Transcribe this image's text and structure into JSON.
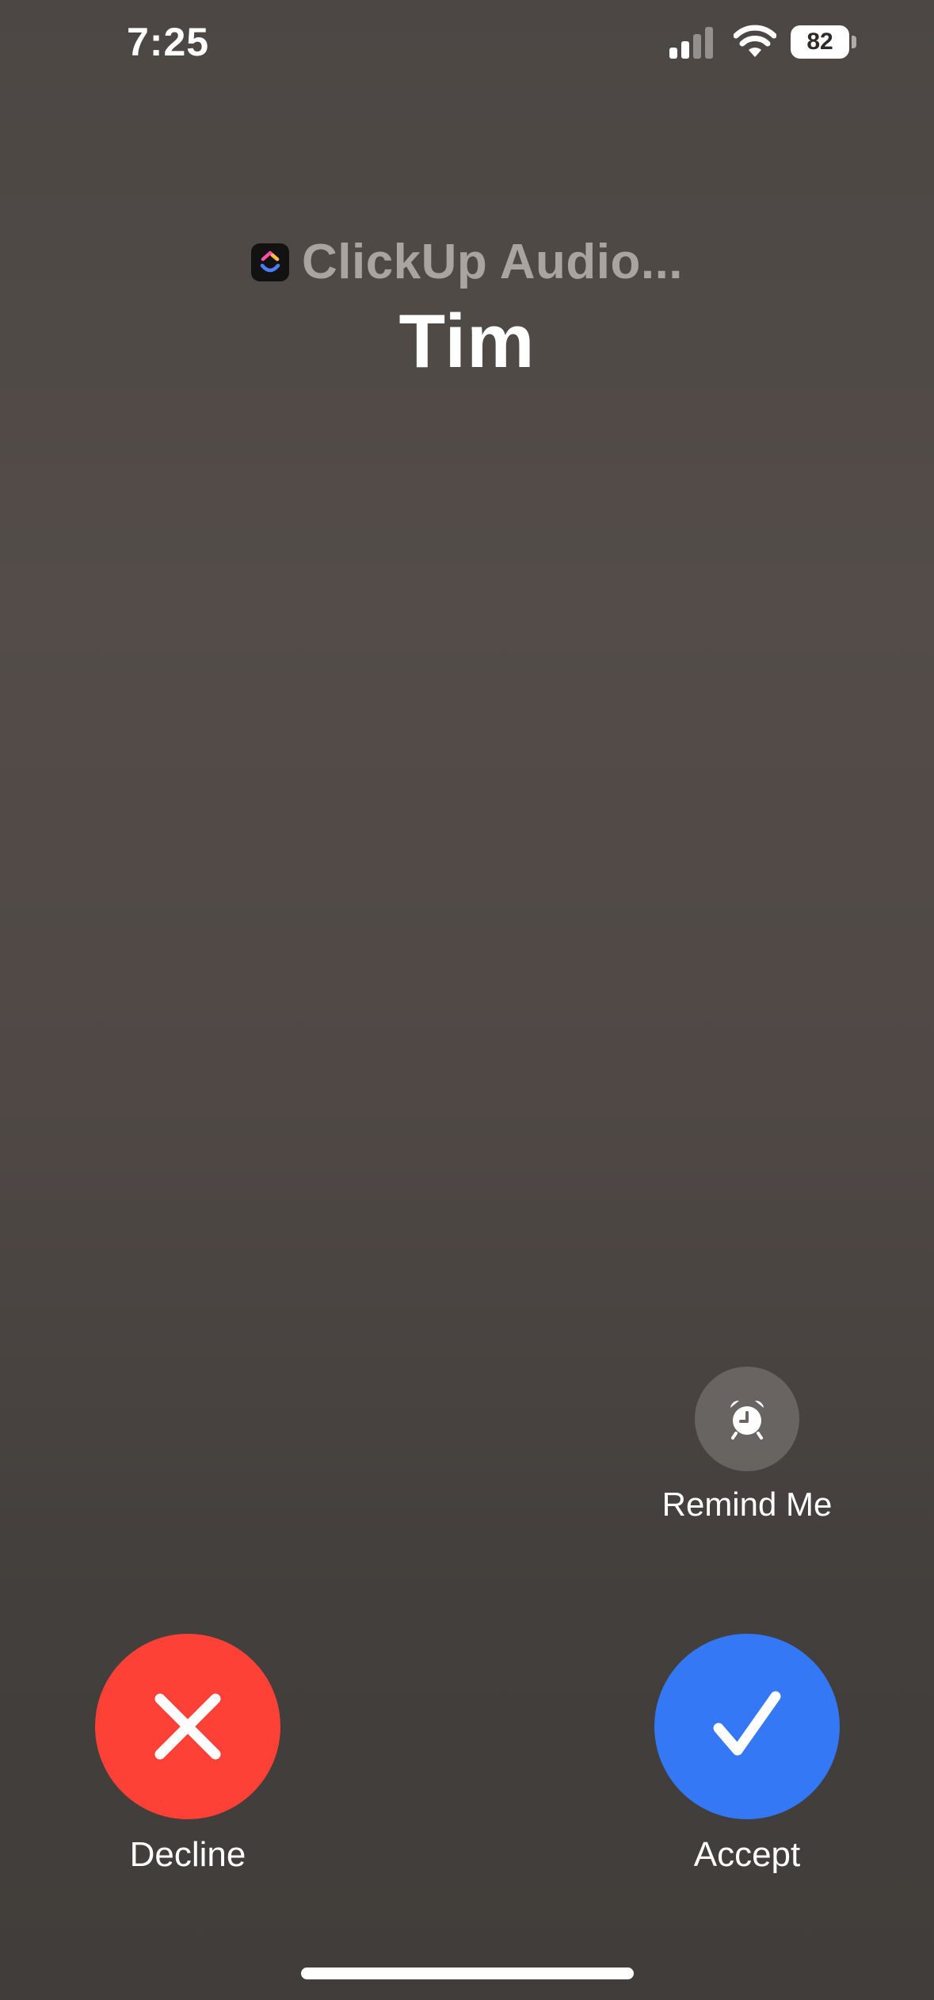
{
  "status_bar": {
    "time": "7:25",
    "signal_icon": "cellular-signal-icon",
    "wifi_icon": "wifi-icon",
    "battery_level": "82"
  },
  "caller": {
    "app_name": "ClickUp Audio...",
    "app_icon": "clickup-app-icon",
    "name": "Tim"
  },
  "actions": {
    "remind_label": "Remind Me",
    "remind_icon": "alarm-clock-icon",
    "decline_label": "Decline",
    "decline_icon": "close-x-icon",
    "accept_label": "Accept",
    "accept_icon": "checkmark-icon"
  },
  "colors": {
    "decline": "#fe4137",
    "accept": "#3478f6",
    "background": "#4f4845"
  }
}
